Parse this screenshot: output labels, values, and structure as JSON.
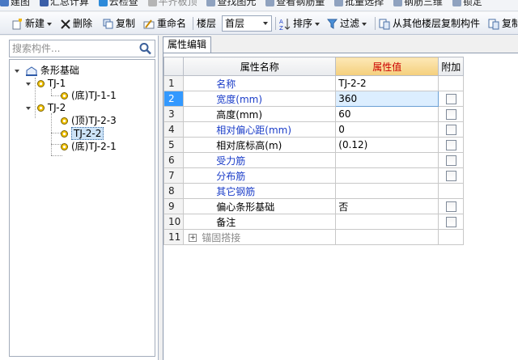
{
  "top_strip": {
    "items": [
      "建图",
      "汇总计算",
      "云检查",
      "平齐板顶",
      "查找图元",
      "查看钢筋量",
      "批量选择",
      "钢筋三维",
      "锁定"
    ]
  },
  "toolbar": {
    "new_label": "新建",
    "delete_label": "删除",
    "copy_label": "复制",
    "rename_label": "重命名",
    "floor_label": "楼层",
    "floor_value": "首层",
    "sort_label": "排序",
    "filter_label": "过滤",
    "copy_from_floor_label": "从其他楼层复制构件",
    "copy_to_label": "复制"
  },
  "search": {
    "placeholder": "搜索构件..."
  },
  "tree": {
    "root": "条形基础",
    "groups": [
      {
        "name": "TJ-1",
        "children": [
          "(底)TJ-1-1"
        ]
      },
      {
        "name": "TJ-2",
        "children": [
          "(顶)TJ-2-3",
          "TJ-2-2",
          "(底)TJ-2-1"
        ]
      }
    ],
    "selected": "TJ-2-2"
  },
  "panel": {
    "tab_label": "属性编辑"
  },
  "table": {
    "headers": [
      "属性名称",
      "属性值",
      "附加"
    ],
    "rows": [
      {
        "index": "1",
        "name": "名称",
        "value": "TJ-2-2",
        "checkbox": false
      },
      {
        "index": "2",
        "name": "宽度(mm)",
        "value": "360",
        "checkbox": true
      },
      {
        "index": "3",
        "name": "高度(mm)",
        "value": "60",
        "checkbox": true
      },
      {
        "index": "4",
        "name": "相对偏心距(mm)",
        "value": "0",
        "checkbox": true
      },
      {
        "index": "5",
        "name": "相对底标高(m)",
        "value": "(0.12)",
        "checkbox": true
      },
      {
        "index": "6",
        "name": "受力筋",
        "value": "",
        "checkbox": true
      },
      {
        "index": "7",
        "name": "分布筋",
        "value": "",
        "checkbox": true
      },
      {
        "index": "8",
        "name": "其它钢筋",
        "value": "",
        "checkbox": false
      },
      {
        "index": "9",
        "name": "偏心条形基础",
        "value": "否",
        "checkbox": true
      },
      {
        "index": "10",
        "name": "备注",
        "value": "",
        "checkbox": true
      },
      {
        "index": "11",
        "name": "锚固搭接",
        "value": "",
        "checkbox": false
      }
    ]
  },
  "colors": {
    "selection": "#3399ff",
    "link_text": "#1a3cc8",
    "value_header": "#cc0000"
  }
}
